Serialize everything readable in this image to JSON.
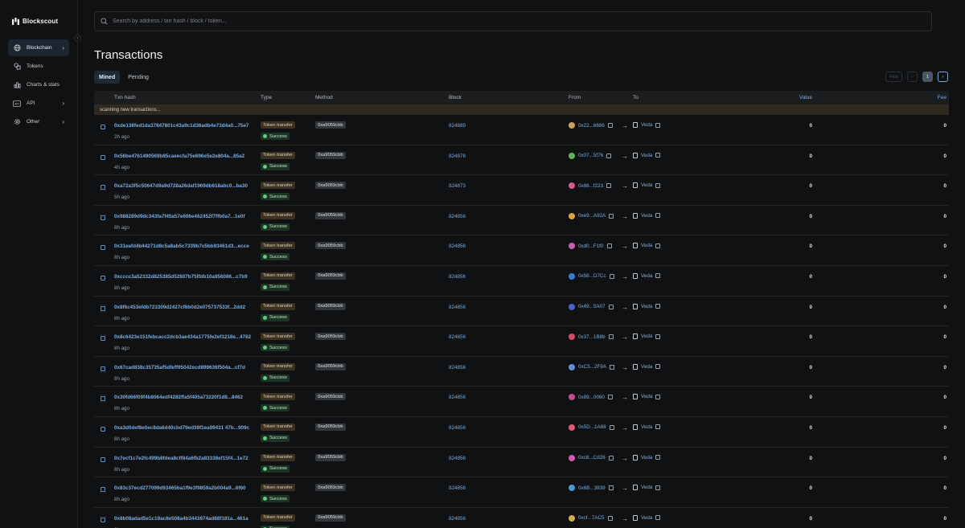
{
  "app": {
    "name": "Blockscout"
  },
  "sidebar": {
    "items": [
      {
        "label": "Blockchain",
        "icon": "globe-icon",
        "chevron": "›",
        "active": true
      },
      {
        "label": "Tokens",
        "icon": "tokens-icon",
        "chevron": "",
        "active": false
      },
      {
        "label": "Charts & stats",
        "icon": "chart-icon",
        "chevron": "",
        "active": false
      },
      {
        "label": "API",
        "icon": "api-icon",
        "chevron": "›",
        "active": false
      },
      {
        "label": "Other",
        "icon": "gear-icon",
        "chevron": "›",
        "active": false
      }
    ]
  },
  "search": {
    "placeholder": "Search by address / txn hash / block / token..."
  },
  "page": {
    "title": "Transactions"
  },
  "tabs": [
    {
      "label": "Mined",
      "active": true
    },
    {
      "label": "Pending",
      "active": false
    }
  ],
  "pager": {
    "first": "First",
    "prev": "‹",
    "current": "1",
    "next": "›"
  },
  "table": {
    "columns": {
      "hash": "Txn hash",
      "type": "Type",
      "method": "Method",
      "block": "Block",
      "from": "From",
      "to": "To",
      "value": "Value",
      "fee": "Fee"
    },
    "scanning": "scanning new transactions...",
    "rows": [
      {
        "hash": "0xde138fed1da37847801c43a9c1d36adb4e73d4a0...75e7",
        "age": "2h ago",
        "type": "Token transfer",
        "status": "Success",
        "method": "0xa9059cbb",
        "block": "824889",
        "from": "0x22...6686",
        "to": "Veda",
        "value": "0",
        "fee": "0",
        "avatar": "#c9a35a"
      },
      {
        "hash": "0x56be4761490569b85caeecfa75e696e5e2e804a...85a2",
        "age": "4h ago",
        "type": "Token transfer",
        "status": "Success",
        "method": "0xa9059cbb",
        "block": "824876",
        "from": "0x07...5f76",
        "to": "Veda",
        "value": "0",
        "fee": "0",
        "avatar": "#5fb35a"
      },
      {
        "hash": "0xa72a3f5c50647d9a9d728a26daf1969db618abc0...ba30",
        "age": "5h ago",
        "type": "Token transfer",
        "status": "Success",
        "method": "0xa9059cbb",
        "block": "824873",
        "from": "0x88...f223",
        "to": "Veda",
        "value": "0",
        "fee": "0",
        "avatar": "#d15a8a"
      },
      {
        "hash": "0x988289d9dc343fa7f45a57e606e462452f7ffb0a7...1e0f",
        "age": "8h ago",
        "type": "Token transfer",
        "status": "Success",
        "method": "0xa9059cbb",
        "block": "824856",
        "from": "0xe9...A92A",
        "to": "Veda",
        "value": "0",
        "fee": "0",
        "avatar": "#e0a23a"
      },
      {
        "hash": "0x31eafd4b44271d8c5a8ab5c7339b7c5bb93461d3...ecce",
        "age": "8h ago",
        "type": "Token transfer",
        "status": "Success",
        "method": "0xa9059cbb",
        "block": "824856",
        "from": "0xd0...F1f0",
        "to": "Veda",
        "value": "0",
        "fee": "0",
        "avatar": "#c95fb0"
      },
      {
        "hash": "0xcccc3a52332d825385d52807b75ffdb10a956086...c7b9",
        "age": "8h ago",
        "type": "Token transfer",
        "status": "Success",
        "method": "0xa9059cbb",
        "block": "824856",
        "from": "0x56...D7Cc",
        "to": "Veda",
        "value": "0",
        "fee": "0",
        "avatar": "#3a7ad1"
      },
      {
        "hash": "0x8f6c453efdb723309d2427cf6b0d2e075737533f...2dd2",
        "age": "8h ago",
        "type": "Token transfer",
        "status": "Success",
        "method": "0xa9059cbb",
        "block": "824856",
        "from": "0x49...5A07",
        "to": "Veda",
        "value": "0",
        "fee": "0",
        "avatar": "#4a5fd1"
      },
      {
        "hash": "0x8c6423e151febcacc2dcb3ae434a1775fe2ef1218e...4762",
        "age": "8h ago",
        "type": "Token transfer",
        "status": "Success",
        "method": "0xa9059cbb",
        "block": "824856",
        "from": "0x37...1B8b",
        "to": "Veda",
        "value": "0",
        "fee": "0",
        "avatar": "#d14a6a"
      },
      {
        "hash": "0x67cad838c35735af5dfeff95042ecd899636f504a...cf7d",
        "age": "8h ago",
        "type": "Token transfer",
        "status": "Success",
        "method": "0xa9059cbb",
        "block": "824856",
        "from": "0xC5...2F9A",
        "to": "Veda",
        "value": "0",
        "fee": "0",
        "avatar": "#6a8ad1"
      },
      {
        "hash": "0x30fd66f09f4b8064edf4282ffa5f405a73220f1d8...8462",
        "age": "8h ago",
        "type": "Token transfer",
        "status": "Success",
        "method": "0xa9059cbb",
        "block": "824856",
        "from": "0x89...0060",
        "to": "Veda",
        "value": "0",
        "fee": "0",
        "avatar": "#c94a8a"
      },
      {
        "hash": "0xa3d0def8e0ec8da6d40cbd79ed38f1ea99431 47b...909c",
        "age": "8h ago",
        "type": "Token transfer",
        "status": "Success",
        "method": "0xa9059cbb",
        "block": "824856",
        "from": "0x5D...1A68",
        "to": "Veda",
        "value": "0",
        "fee": "0",
        "avatar": "#e05a7a"
      },
      {
        "hash": "0x7ecf1c7e2fc499b8fdea8cff84a6fb2a83338ef15f4...1e72",
        "age": "8h ago",
        "type": "Token transfer",
        "status": "Success",
        "method": "0xa9059cbb",
        "block": "824856",
        "from": "0xc8...Cd28",
        "to": "Veda",
        "value": "0",
        "fee": "0",
        "avatar": "#d15ab0"
      },
      {
        "hash": "0x83c37ecd277099d93465ba1f9e3f9859a2b004a9...6f60",
        "age": "8h ago",
        "type": "Token transfer",
        "status": "Success",
        "method": "0xa9059cbb",
        "block": "824856",
        "from": "0x6B...3939",
        "to": "Veda",
        "value": "0",
        "fee": "0",
        "avatar": "#4a9ad1"
      },
      {
        "hash": "0x8b08adad5e1c19ac8e508a4b3443874ad88f181a...461a",
        "age": "8h ago",
        "type": "Token transfer",
        "status": "Success",
        "method": "0xa9059cbb",
        "block": "824856",
        "from": "0xcf...7AC5",
        "to": "Veda",
        "value": "0",
        "fee": "0",
        "avatar": "#d1b04a"
      }
    ]
  }
}
